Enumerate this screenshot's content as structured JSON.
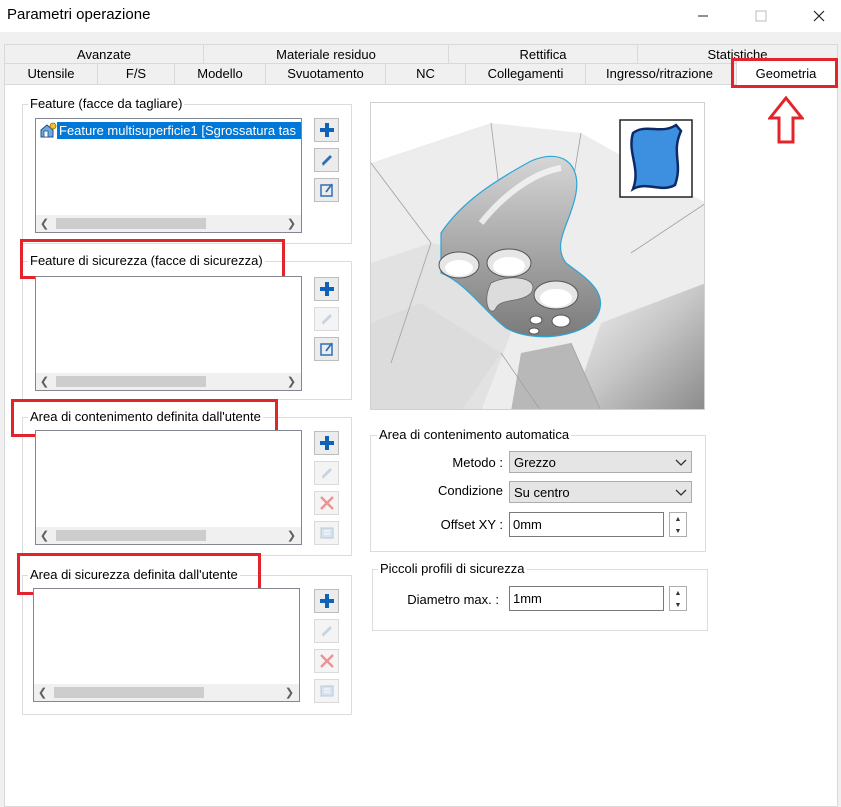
{
  "window": {
    "title": "Parametri operazione",
    "minimize_icon": "minimize-icon",
    "maximize_icon": "maximize-icon",
    "close_icon": "close-icon"
  },
  "tabs": {
    "row_back": [
      "Avanzate",
      "Materiale residuo",
      "Rettifica",
      "Statistiche"
    ],
    "row_front": [
      "Utensile",
      "F/S",
      "Modello",
      "Svuotamento",
      "NC",
      "Collegamenti",
      "Ingresso/ritrazione",
      "Geometria"
    ],
    "active": "Geometria"
  },
  "feature_group": {
    "label": "Feature (facce da tagliare)",
    "items": [
      "Feature multisuperficie1 [Sgrossatura tas"
    ],
    "selected_color": "#0078d7"
  },
  "safety_feature_group": {
    "label": "Feature di sicurezza (facce di sicurezza)"
  },
  "user_contain_group": {
    "label": "Area di contenimento definita dall'utente"
  },
  "user_safety_group": {
    "label": "Area di sicurezza definita dall'utente"
  },
  "auto_contain_group": {
    "label": "Area di contenimento automatica",
    "metodo_label": "Metodo :",
    "metodo_value": "Grezzo",
    "condizione_label": "Condizione",
    "condizione_value": "Su centro",
    "offset_label": "Offset XY :",
    "offset_value": "0mm"
  },
  "small_profiles_group": {
    "label": "Piccoli profili di sicurezza",
    "diametro_label": "Diametro max. :",
    "diametro_value": "1mm"
  },
  "colors": {
    "annotation_red": "#e3242b",
    "add_icon_blue": "#0e62b8",
    "delete_icon_red": "#e03b3b",
    "face_preview_blue": "#3d8fe0"
  }
}
